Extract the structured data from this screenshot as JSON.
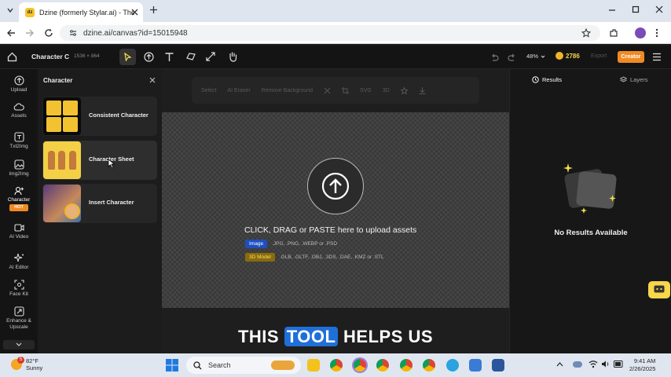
{
  "browser": {
    "tab_title": "Dzine (formerly Stylar.ai) - The",
    "favicon_text": "dz",
    "url": "dzine.ai/canvas?id=15015948"
  },
  "topbar": {
    "project_name": "Character C",
    "canvas_size": "1536 × 864",
    "zoom": "48%",
    "credits": "2786",
    "export_label": "Export",
    "creator_label": "Creator"
  },
  "sidebar": {
    "items": [
      {
        "label": "Upload",
        "icon": "upload-icon"
      },
      {
        "label": "Assets",
        "icon": "cloud-icon"
      },
      {
        "label": "Txt2Img",
        "icon": "text-image-icon"
      },
      {
        "label": "Img2Img",
        "icon": "image-icon"
      },
      {
        "label": "Character",
        "icon": "character-icon",
        "badge": "HOT"
      },
      {
        "label": "AI Video",
        "icon": "video-icon"
      },
      {
        "label": "AI Editor",
        "icon": "sparkle-icon"
      },
      {
        "label": "Face Kit",
        "icon": "face-icon"
      },
      {
        "label": "Enhance & Upscale",
        "icon": "enhance-icon"
      }
    ]
  },
  "panel": {
    "title": "Character",
    "cards": [
      {
        "label": "Consistent Character"
      },
      {
        "label": "Character Sheet"
      },
      {
        "label": "Insert Character"
      }
    ]
  },
  "canvas_toolbar": {
    "items": [
      "Select",
      "AI Eraser",
      "Remove Background",
      "SVG",
      "3D"
    ]
  },
  "upload": {
    "main_text": "CLICK, DRAG or PASTE here to upload assets",
    "image_badge": "Image",
    "image_formats": ".JPG, .PNG, .WEBP or .PSD",
    "model_badge": "3D Model",
    "model_formats": ".GLB, .GLTF, .OBJ, .3DS, .DAE, .KMZ or .STL"
  },
  "right_panel": {
    "tab_results": "Results",
    "tab_layers": "Layers",
    "empty_text": "No Results Available"
  },
  "caption": {
    "before": "THIS ",
    "highlight": "TOOL",
    "after": " HELPS US"
  },
  "taskbar": {
    "weather_temp": "82°F",
    "weather_desc": "Sunny",
    "weather_badge": "5",
    "search_placeholder": "Search",
    "time": "9:41 AM",
    "date": "2/26/2025"
  },
  "colors": {
    "accent_yellow": "#f6e04a",
    "creator_orange": "#f08a24",
    "image_badge": "#1e4fbf",
    "model_badge": "#8a6a10"
  }
}
